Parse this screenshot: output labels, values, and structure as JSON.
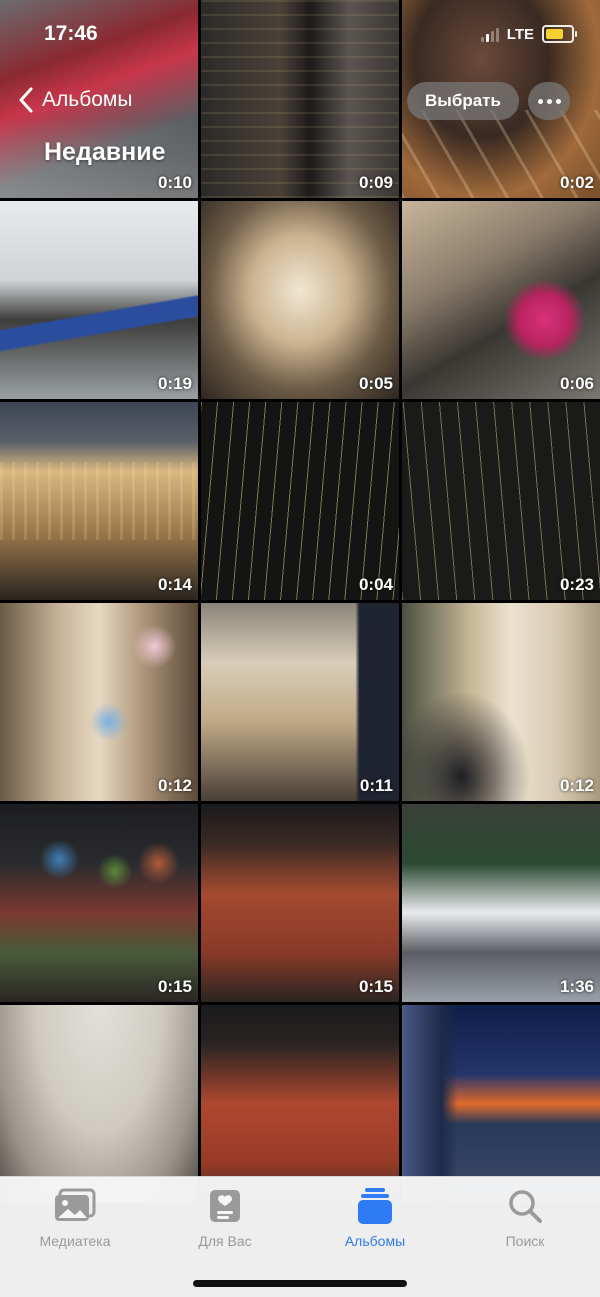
{
  "status_bar": {
    "time": "17:46",
    "network": "LTE"
  },
  "nav": {
    "back_label": "Альбомы",
    "title": "Недавние",
    "select_label": "Выбрать"
  },
  "grid": {
    "items": [
      {
        "duration": "0:10"
      },
      {
        "duration": "0:09"
      },
      {
        "duration": "0:02"
      },
      {
        "duration": "0:19"
      },
      {
        "duration": "0:05"
      },
      {
        "duration": "0:06"
      },
      {
        "duration": "0:14"
      },
      {
        "duration": "0:04"
      },
      {
        "duration": "0:23"
      },
      {
        "duration": "0:12"
      },
      {
        "duration": "0:11"
      },
      {
        "duration": "0:12"
      },
      {
        "duration": "0:15"
      },
      {
        "duration": "0:15"
      },
      {
        "duration": "1:36"
      },
      {
        "duration": ""
      },
      {
        "duration": ""
      },
      {
        "duration": ""
      }
    ]
  },
  "tabbar": {
    "tabs": [
      {
        "label": "Медиатека",
        "icon": "photos-library-icon"
      },
      {
        "label": "Для Вас",
        "icon": "for-you-icon"
      },
      {
        "label": "Альбомы",
        "icon": "albums-icon"
      },
      {
        "label": "Поиск",
        "icon": "search-icon"
      }
    ],
    "active_color": "#2f7bf5",
    "inactive_color": "#9a9a9a"
  }
}
